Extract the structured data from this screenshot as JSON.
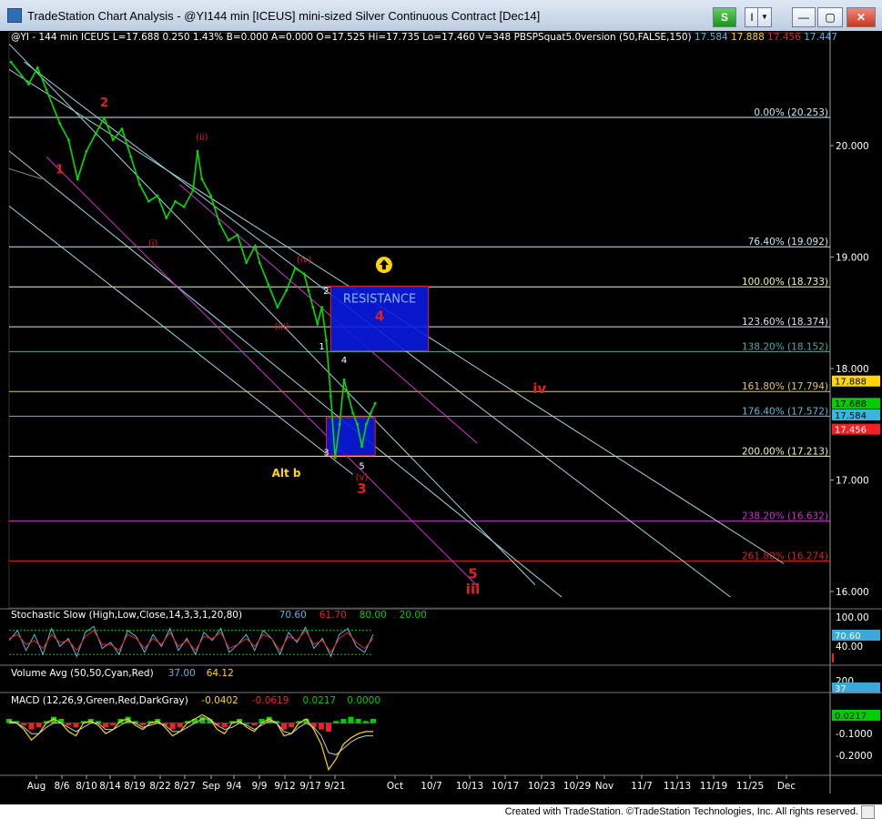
{
  "window": {
    "title": "TradeStation Chart Analysis - @YI144 min [ICEUS] mini-sized Silver Continuous Contract [Dec14]",
    "buttons": {
      "strategy": "S",
      "indicator": "I",
      "dropdown": "▼",
      "minimize": "—",
      "maximize": "▢",
      "close": "✕"
    }
  },
  "footer": {
    "credit": "Created with TradeStation. ©TradeStation Technologies, Inc. All rights reserved."
  },
  "colors": {
    "price": "#00dd00",
    "background": "#000000",
    "channel_cyan": "#9fd6dc",
    "channel_magenta": "#cc33cc",
    "fib_line": "#cfe6ea",
    "label_red": "#e02020",
    "resistance_box": "#0a1ae0"
  },
  "chart_data": {
    "type": "line",
    "symbol_header": {
      "name": "@YI - 144 min",
      "exchange": "ICEUS",
      "last": "L=17.688",
      "change": "0.250",
      "pct": "1.43%",
      "bid": "B=0.000",
      "ask": "A=0.000",
      "open": "O=17.525",
      "high": "Hi=17.735",
      "low": "Lo=17.460",
      "volume": "V=348",
      "study": "PBSPSquat5.0version (50,FALSE,150)",
      "study_values": [
        "17.584",
        "17.888",
        "17.456",
        "17.447"
      ]
    },
    "price_axis": {
      "ticks": [
        "20.000",
        "19.000",
        "18.000",
        "17.000",
        "16.000"
      ],
      "ylim": [
        15.7,
        20.95
      ]
    },
    "price_series": [
      {
        "x": 0,
        "y": 20.75
      },
      {
        "x": 4,
        "y": 20.55
      },
      {
        "x": 6,
        "y": 20.7
      },
      {
        "x": 8,
        "y": 20.5
      },
      {
        "x": 11,
        "y": 20.2
      },
      {
        "x": 13,
        "y": 20.05
      },
      {
        "x": 15,
        "y": 19.7
      },
      {
        "x": 17,
        "y": 19.95
      },
      {
        "x": 19,
        "y": 20.1
      },
      {
        "x": 21,
        "y": 20.25
      },
      {
        "x": 23,
        "y": 20.05
      },
      {
        "x": 25,
        "y": 20.15
      },
      {
        "x": 27,
        "y": 19.9
      },
      {
        "x": 29,
        "y": 19.65
      },
      {
        "x": 31,
        "y": 19.5
      },
      {
        "x": 33,
        "y": 19.55
      },
      {
        "x": 35,
        "y": 19.35
      },
      {
        "x": 37,
        "y": 19.5
      },
      {
        "x": 39,
        "y": 19.45
      },
      {
        "x": 41,
        "y": 19.6
      },
      {
        "x": 42,
        "y": 19.95
      },
      {
        "x": 43,
        "y": 19.7
      },
      {
        "x": 45,
        "y": 19.55
      },
      {
        "x": 47,
        "y": 19.3
      },
      {
        "x": 49,
        "y": 19.15
      },
      {
        "x": 51,
        "y": 19.2
      },
      {
        "x": 53,
        "y": 18.95
      },
      {
        "x": 55,
        "y": 19.1
      },
      {
        "x": 56,
        "y": 18.95
      },
      {
        "x": 58,
        "y": 18.75
      },
      {
        "x": 60,
        "y": 18.55
      },
      {
        "x": 62,
        "y": 18.7
      },
      {
        "x": 64,
        "y": 18.9
      },
      {
        "x": 66,
        "y": 18.85
      },
      {
        "x": 67,
        "y": 18.7
      },
      {
        "x": 68,
        "y": 18.55
      },
      {
        "x": 69,
        "y": 18.4
      },
      {
        "x": 70,
        "y": 18.55
      },
      {
        "x": 71,
        "y": 18.25
      },
      {
        "x": 72,
        "y": 17.75
      },
      {
        "x": 73,
        "y": 17.2
      },
      {
        "x": 74,
        "y": 17.5
      },
      {
        "x": 75,
        "y": 17.9
      },
      {
        "x": 76,
        "y": 17.75
      },
      {
        "x": 77,
        "y": 17.6
      },
      {
        "x": 78,
        "y": 17.5
      },
      {
        "x": 79,
        "y": 17.3
      },
      {
        "x": 80,
        "y": 17.5
      },
      {
        "x": 81,
        "y": 17.6
      },
      {
        "x": 82,
        "y": 17.688
      }
    ],
    "x_axis": {
      "labels": [
        "Aug",
        "8/6",
        "8/10",
        "8/14",
        "8/19",
        "8/22",
        "8/27",
        "Sep",
        "9/4",
        "9/9",
        "9/12",
        "9/17",
        "9/21",
        "Oct",
        "10/7",
        "10/13",
        "10/17",
        "10/23",
        "10/29",
        "Nov",
        "11/7",
        "11/13",
        "11/19",
        "11/25",
        "Dec"
      ]
    },
    "fib_levels": [
      {
        "label": "0.00% (20.253)",
        "value": 20.253,
        "color": "#cfe6ea"
      },
      {
        "label": "76.40% (19.092)",
        "value": 19.092,
        "color": "#cfe6ea"
      },
      {
        "label": "100.00% (18.733)",
        "value": 18.733,
        "color": "#f0f0c0"
      },
      {
        "label": "123.60% (18.374)",
        "value": 18.374,
        "color": "#cfe6ea"
      },
      {
        "label": "138.20% (18.152)",
        "value": 18.152,
        "color": "#4fa8a0"
      },
      {
        "label": "161.80% (17.794)",
        "value": 17.794,
        "color": "#d8c860"
      },
      {
        "label": "176.40% (17.572)",
        "value": 17.572,
        "color": "#60b8d8"
      },
      {
        "label": "200.00% (17.213)",
        "value": 17.213,
        "color": "#f0f0c0"
      },
      {
        "label": "238.20% (16.632)",
        "value": 16.632,
        "color": "#cc33cc"
      },
      {
        "label": "261.80% (16.274)",
        "value": 16.274,
        "color": "#e02020"
      }
    ],
    "price_tags": [
      {
        "text": "17.888",
        "bg": "#ffd700",
        "fg": "#000"
      },
      {
        "text": "17.688",
        "bg": "#00cc00",
        "fg": "#000"
      },
      {
        "text": "17.584",
        "bg": "#38b8d8",
        "fg": "#000"
      },
      {
        "text": "17.456",
        "bg": "#ee2222",
        "fg": "#fff"
      }
    ],
    "boxes": [
      {
        "label": "RESISTANCE",
        "sub": "4",
        "x0": 72,
        "x1": 94,
        "y0": 18.74,
        "y1": 18.16
      },
      {
        "label": "",
        "sub": "",
        "x0": 71,
        "x1": 82,
        "y0": 17.56,
        "y1": 17.22
      }
    ],
    "wave_labels": [
      {
        "text": "1",
        "x": 11,
        "y": 19.75,
        "color": "#e02020",
        "size": 13
      },
      {
        "text": "2",
        "x": 21,
        "y": 20.35,
        "color": "#e02020",
        "size": 13
      },
      {
        "text": "(i)",
        "x": 32,
        "y": 19.1,
        "color": "#e02020",
        "size": 10
      },
      {
        "text": "(ii)",
        "x": 43,
        "y": 20.05,
        "color": "#e02020",
        "size": 10
      },
      {
        "text": "(iii)",
        "x": 61,
        "y": 18.35,
        "color": "#e02020",
        "size": 10
      },
      {
        "text": "(iv)",
        "x": 66,
        "y": 18.95,
        "color": "#e02020",
        "size": 10
      },
      {
        "text": "2",
        "x": 71,
        "y": 18.67,
        "color": "#ffffff",
        "size": 10
      },
      {
        "text": "1",
        "x": 70,
        "y": 18.17,
        "color": "#ffffff",
        "size": 10
      },
      {
        "text": "4",
        "x": 75,
        "y": 18.05,
        "color": "#ffffff",
        "size": 10
      },
      {
        "text": "3",
        "x": 71,
        "y": 17.22,
        "color": "#ffffff",
        "size": 10
      },
      {
        "text": "5",
        "x": 79,
        "y": 17.1,
        "color": "#ffffff",
        "size": 10
      },
      {
        "text": "(v)",
        "x": 79,
        "y": 17.0,
        "color": "#e02020",
        "size": 10
      },
      {
        "text": "3",
        "x": 79,
        "y": 16.88,
        "color": "#e02020",
        "size": 15
      },
      {
        "text": "Alt b",
        "x": 62,
        "y": 17.03,
        "color": "#ffd700",
        "size": 12
      },
      {
        "text": "iv",
        "x": 119,
        "y": 17.78,
        "color": "#e02020",
        "size": 15
      },
      {
        "text": "5",
        "x": 104,
        "y": 16.12,
        "color": "#e02020",
        "size": 15
      },
      {
        "text": "iii",
        "x": 104,
        "y": 15.98,
        "color": "#e02020",
        "size": 15
      }
    ],
    "channels": [
      {
        "x0": -5,
        "y0": 21.1,
        "x1": 118,
        "y1": 16.06,
        "color": "#9fd6dc"
      },
      {
        "x0": 3,
        "y0": 20.75,
        "x1": 162,
        "y1": 15.95,
        "color": "#9fd6dc"
      },
      {
        "x0": -5,
        "y0": 20.8,
        "x1": 174,
        "y1": 16.25,
        "color": "#9fd6dc"
      },
      {
        "x0": -5,
        "y0": 20.1,
        "x1": 124,
        "y1": 15.95,
        "color": "#9fd6dc"
      },
      {
        "x0": -5,
        "y0": 19.6,
        "x1": 77,
        "y1": 17.05,
        "color": "#9fd6dc"
      },
      {
        "x0": -5,
        "y0": 15.85,
        "x1": 7,
        "y1": 15.65,
        "color": "#9fd6dc"
      },
      {
        "x0": 8,
        "y0": 19.9,
        "x1": 105,
        "y1": 16.05,
        "color": "#cc33cc"
      },
      {
        "x0": 38,
        "y0": 19.65,
        "x1": 105,
        "y1": 17.33,
        "color": "#cc33cc"
      },
      {
        "x0": -5,
        "y0": 19.85,
        "x1": 7,
        "y1": 19.7,
        "color": "#888888"
      }
    ],
    "arrow_marker": {
      "x": 84,
      "y": 18.93,
      "color": "#ffd700"
    },
    "stochastic": {
      "title": "Stochastic Slow (High,Low,Close,14,3,3,1,20,80)",
      "values": [
        "70.60",
        "61.70",
        "80.00",
        "20.00"
      ],
      "value_colors": [
        "#55b8e0",
        "#ee2222",
        "#00cc00",
        "#00cc00"
      ],
      "axis_ticks": [
        "100.00",
        "40.00"
      ],
      "levels": [
        80,
        20
      ],
      "k": [
        55,
        80,
        30,
        70,
        20,
        85,
        40,
        60,
        15,
        75,
        90,
        35,
        50,
        20,
        80,
        65,
        25,
        70,
        40,
        85,
        30,
        60,
        20,
        75,
        55,
        85,
        25,
        45,
        70,
        30,
        80,
        60,
        20,
        75,
        50,
        88,
        35,
        60,
        15,
        70,
        85,
        40,
        25,
        70
      ],
      "d": [
        60,
        70,
        45,
        55,
        35,
        70,
        50,
        55,
        30,
        65,
        80,
        45,
        45,
        30,
        70,
        60,
        35,
        60,
        45,
        75,
        40,
        55,
        30,
        65,
        60,
        75,
        35,
        45,
        60,
        40,
        70,
        60,
        30,
        65,
        55,
        80,
        45,
        55,
        25,
        60,
        75,
        50,
        35,
        60
      ]
    },
    "volume": {
      "title": "Volume Avg (50,50,Cyan,Red)",
      "values": [
        "37.00",
        "64.12"
      ],
      "value_colors": [
        "#55b8e0",
        "#ffd700"
      ],
      "axis_ticks": [
        "200"
      ],
      "tag": "37"
    },
    "macd": {
      "title": "MACD (12,26,9,Green,Red,DarkGray)",
      "values": [
        "-0.0402",
        "-0.0619",
        "0.0217",
        "0.0000"
      ],
      "value_colors": [
        "#ffd700",
        "#ee2222",
        "#00cc00",
        "#00cc00"
      ],
      "axis_ticks": [
        "-0.1000",
        "-0.2000"
      ],
      "tag": "0.0217",
      "hist": [
        0.02,
        0.01,
        -0.01,
        -0.03,
        -0.02,
        0.01,
        0.03,
        0.02,
        -0.01,
        -0.02,
        0.01,
        0.02,
        0.01,
        -0.02,
        -0.01,
        0.02,
        0.03,
        0.01,
        -0.01,
        0.01,
        0.02,
        -0.01,
        -0.03,
        -0.02,
        0.01,
        0.02,
        0.03,
        0.02,
        -0.01,
        -0.02,
        0.01,
        0.02,
        0.0,
        -0.01,
        0.02,
        0.03,
        0.01,
        -0.03,
        -0.02,
        0.01,
        0.02,
        -0.02,
        -0.03,
        -0.04,
        0.01,
        0.02,
        0.03,
        0.02,
        0.01,
        0.02
      ],
      "macd_line": [
        0.01,
        0.0,
        -0.03,
        -0.08,
        -0.05,
        0.0,
        0.02,
        0.0,
        -0.04,
        -0.06,
        0.0,
        0.01,
        -0.01,
        -0.05,
        -0.03,
        0.01,
        0.02,
        -0.01,
        -0.03,
        0.0,
        0.01,
        -0.02,
        -0.06,
        -0.04,
        0.0,
        0.02,
        0.04,
        0.02,
        -0.03,
        -0.05,
        0.0,
        0.01,
        -0.02,
        -0.04,
        0.0,
        0.02,
        0.0,
        -0.06,
        -0.05,
        0.0,
        0.02,
        -0.03,
        -0.1,
        -0.22,
        -0.17,
        -0.1,
        -0.07,
        -0.05,
        -0.04,
        -0.04
      ],
      "signal_line": [
        0.0,
        0.0,
        -0.02,
        -0.05,
        -0.05,
        -0.02,
        0.0,
        0.0,
        -0.02,
        -0.04,
        -0.02,
        0.0,
        0.0,
        -0.03,
        -0.03,
        -0.01,
        0.01,
        0.0,
        -0.02,
        -0.01,
        0.0,
        -0.01,
        -0.04,
        -0.04,
        -0.02,
        0.0,
        0.02,
        0.02,
        -0.01,
        -0.03,
        -0.02,
        0.0,
        -0.01,
        -0.03,
        -0.01,
        0.01,
        0.0,
        -0.04,
        -0.05,
        -0.02,
        0.0,
        -0.02,
        -0.06,
        -0.14,
        -0.15,
        -0.12,
        -0.09,
        -0.07,
        -0.06,
        -0.06
      ]
    }
  }
}
